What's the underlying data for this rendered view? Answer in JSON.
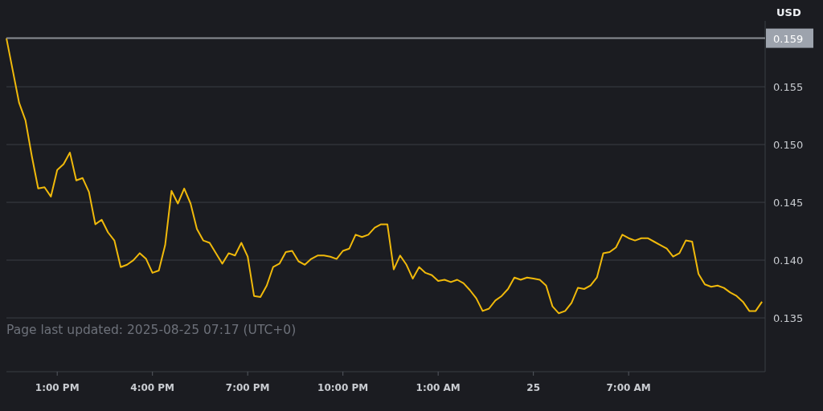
{
  "chart": {
    "chart_data": {
      "type": "line",
      "grid": true,
      "x": [
        "2025-08-24T11:24:00Z",
        "2025-08-24T11:36:00Z",
        "2025-08-24T11:48:00Z",
        "2025-08-24T12:00:00Z",
        "2025-08-24T12:12:00Z",
        "2025-08-24T12:24:00Z",
        "2025-08-24T12:36:00Z",
        "2025-08-24T12:48:00Z",
        "2025-08-24T13:00:00Z",
        "2025-08-24T13:12:00Z",
        "2025-08-24T13:24:00Z",
        "2025-08-24T13:36:00Z",
        "2025-08-24T13:48:00Z",
        "2025-08-24T14:00:00Z",
        "2025-08-24T14:12:00Z",
        "2025-08-24T14:24:00Z",
        "2025-08-24T14:36:00Z",
        "2025-08-24T14:48:00Z",
        "2025-08-24T15:00:00Z",
        "2025-08-24T15:12:00Z",
        "2025-08-24T15:24:00Z",
        "2025-08-24T15:36:00Z",
        "2025-08-24T15:48:00Z",
        "2025-08-24T16:00:00Z",
        "2025-08-24T16:12:00Z",
        "2025-08-24T16:24:00Z",
        "2025-08-24T16:36:00Z",
        "2025-08-24T16:48:00Z",
        "2025-08-24T17:00:00Z",
        "2025-08-24T17:12:00Z",
        "2025-08-24T17:24:00Z",
        "2025-08-24T17:36:00Z",
        "2025-08-24T17:48:00Z",
        "2025-08-24T18:00:00Z",
        "2025-08-24T18:12:00Z",
        "2025-08-24T18:24:00Z",
        "2025-08-24T18:36:00Z",
        "2025-08-24T18:48:00Z",
        "2025-08-24T19:00:00Z",
        "2025-08-24T19:12:00Z",
        "2025-08-24T19:24:00Z",
        "2025-08-24T19:36:00Z",
        "2025-08-24T19:48:00Z",
        "2025-08-24T20:00:00Z",
        "2025-08-24T20:12:00Z",
        "2025-08-24T20:24:00Z",
        "2025-08-24T20:36:00Z",
        "2025-08-24T20:48:00Z",
        "2025-08-24T21:00:00Z",
        "2025-08-24T21:12:00Z",
        "2025-08-24T21:24:00Z",
        "2025-08-24T21:36:00Z",
        "2025-08-24T21:48:00Z",
        "2025-08-24T22:00:00Z",
        "2025-08-24T22:12:00Z",
        "2025-08-24T22:24:00Z",
        "2025-08-24T22:36:00Z",
        "2025-08-24T22:48:00Z",
        "2025-08-24T23:00:00Z",
        "2025-08-24T23:12:00Z",
        "2025-08-24T23:24:00Z",
        "2025-08-24T23:36:00Z",
        "2025-08-24T23:48:00Z",
        "2025-08-25T00:00:00Z",
        "2025-08-25T00:12:00Z",
        "2025-08-25T00:24:00Z",
        "2025-08-25T00:36:00Z",
        "2025-08-25T00:48:00Z",
        "2025-08-25T01:00:00Z",
        "2025-08-25T01:12:00Z",
        "2025-08-25T01:24:00Z",
        "2025-08-25T01:36:00Z",
        "2025-08-25T01:48:00Z",
        "2025-08-25T02:00:00Z",
        "2025-08-25T02:12:00Z",
        "2025-08-25T02:24:00Z",
        "2025-08-25T02:36:00Z",
        "2025-08-25T02:48:00Z",
        "2025-08-25T03:00:00Z",
        "2025-08-25T03:12:00Z",
        "2025-08-25T03:24:00Z",
        "2025-08-25T03:36:00Z",
        "2025-08-25T03:48:00Z",
        "2025-08-25T04:00:00Z",
        "2025-08-25T04:12:00Z",
        "2025-08-25T04:24:00Z",
        "2025-08-25T04:36:00Z",
        "2025-08-25T04:48:00Z",
        "2025-08-25T05:00:00Z",
        "2025-08-25T05:12:00Z",
        "2025-08-25T05:24:00Z",
        "2025-08-25T05:36:00Z",
        "2025-08-25T05:48:00Z",
        "2025-08-25T06:00:00Z",
        "2025-08-25T06:12:00Z",
        "2025-08-25T06:24:00Z",
        "2025-08-25T06:36:00Z",
        "2025-08-25T06:48:00Z",
        "2025-08-25T07:00:00Z",
        "2025-08-25T07:12:00Z",
        "2025-08-25T07:24:00Z",
        "2025-08-25T07:36:00Z",
        "2025-08-25T07:48:00Z",
        "2025-08-25T08:00:00Z",
        "2025-08-25T08:12:00Z",
        "2025-08-25T08:24:00Z",
        "2025-08-25T08:36:00Z",
        "2025-08-25T08:48:00Z",
        "2025-08-25T09:00:00Z",
        "2025-08-25T09:12:00Z",
        "2025-08-25T09:24:00Z",
        "2025-08-25T09:36:00Z",
        "2025-08-25T09:48:00Z",
        "2025-08-25T10:00:00Z",
        "2025-08-25T10:12:00Z",
        "2025-08-25T10:24:00Z",
        "2025-08-25T10:36:00Z",
        "2025-08-25T10:48:00Z",
        "2025-08-25T11:00:00Z",
        "2025-08-25T11:12:00Z"
      ],
      "ylabel": "USD",
      "series": [
        {
          "color": "#f0b90b",
          "values": [
            0.1592,
            0.1564,
            0.1536,
            0.1521,
            0.149,
            0.1462,
            0.1463,
            0.1455,
            0.1478,
            0.1483,
            0.1493,
            0.1469,
            0.1471,
            0.1459,
            0.1431,
            0.1435,
            0.1424,
            0.1417,
            0.1394,
            0.1396,
            0.14,
            0.1406,
            0.1401,
            0.1389,
            0.1391,
            0.1413,
            0.146,
            0.1449,
            0.1462,
            0.1449,
            0.1427,
            0.1417,
            0.1415,
            0.1406,
            0.1397,
            0.1406,
            0.1404,
            0.1415,
            0.1403,
            0.1369,
            0.1368,
            0.1378,
            0.1394,
            0.1397,
            0.1407,
            0.1408,
            0.1399,
            0.1396,
            0.1401,
            0.1404,
            0.1404,
            0.1403,
            0.1401,
            0.1408,
            0.141,
            0.1422,
            0.142,
            0.1422,
            0.1428,
            0.1431,
            0.1431,
            0.1392,
            0.1404,
            0.1396,
            0.1384,
            0.1394,
            0.1389,
            0.1387,
            0.1382,
            0.1383,
            0.1381,
            0.1383,
            0.138,
            0.1374,
            0.1367,
            0.1356,
            0.1358,
            0.1365,
            0.1369,
            0.1375,
            0.1385,
            0.1383,
            0.1385,
            0.1384,
            0.1383,
            0.1378,
            0.136,
            0.1354,
            0.1356,
            0.1363,
            0.1376,
            0.1375,
            0.1378,
            0.1385,
            0.1406,
            0.1407,
            0.1411,
            0.1422,
            0.1419,
            0.1417,
            0.1419,
            0.1419,
            0.1416,
            0.1413,
            0.141,
            0.1403,
            0.1406,
            0.1417,
            0.1416,
            0.1388,
            0.1379,
            0.1377,
            0.1378,
            0.1376,
            0.1372,
            0.1369,
            0.1364,
            0.1356,
            0.1356,
            0.1364
          ]
        }
      ],
      "xlim": [
        "2025-08-24T11:24:00Z",
        "2025-08-25T11:18:00Z"
      ],
      "ylim": [
        0.13035,
        0.1607
      ],
      "xticks": [
        {
          "value": "2025-08-24T13:00:00Z",
          "label": "1:00 PM"
        },
        {
          "value": "2025-08-24T16:00:00Z",
          "label": "4:00 PM"
        },
        {
          "value": "2025-08-24T19:00:00Z",
          "label": "7:00 PM"
        },
        {
          "value": "2025-08-24T22:00:00Z",
          "label": "10:00 PM"
        },
        {
          "value": "2025-08-25T01:00:00Z",
          "label": "1:00 AM"
        },
        {
          "value": "2025-08-25T04:00:00Z",
          "label": "25"
        },
        {
          "value": "2025-08-25T07:00:00Z",
          "label": "7:00 AM"
        }
      ],
      "yticks": [
        {
          "value": 0.135,
          "label": "0.135"
        },
        {
          "value": 0.14,
          "label": "0.140"
        },
        {
          "value": 0.145,
          "label": "0.145"
        },
        {
          "value": 0.15,
          "label": "0.150"
        },
        {
          "value": 0.155,
          "label": "0.155"
        }
      ],
      "ref_lines": [
        {
          "axis": "y",
          "value": 0.1592,
          "label": "0.159"
        }
      ]
    },
    "last_updated": "Page last updated: 2025-08-25 07:17 (UTC+0)"
  }
}
